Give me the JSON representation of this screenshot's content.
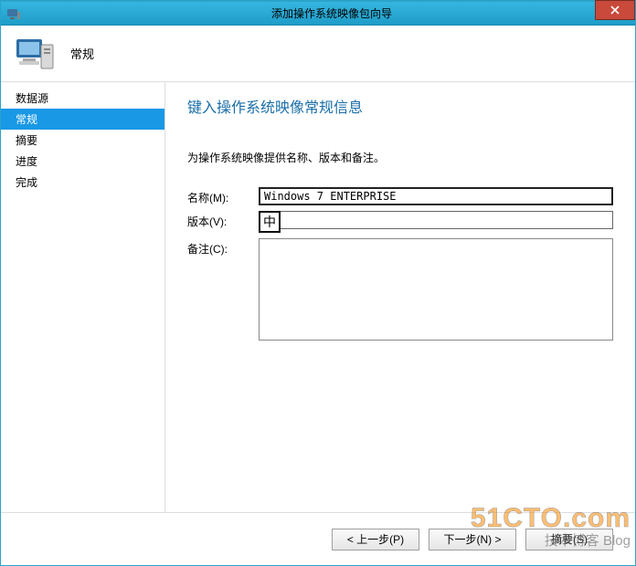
{
  "titlebar": {
    "title": "添加操作系统映像包向导",
    "close_label": "×"
  },
  "header": {
    "title": "常规"
  },
  "sidebar": {
    "items": [
      {
        "label": "数据源"
      },
      {
        "label": "常规"
      },
      {
        "label": "摘要"
      },
      {
        "label": "进度"
      },
      {
        "label": "完成"
      }
    ],
    "selected_index": 1
  },
  "content": {
    "heading": "键入操作系统映像常规信息",
    "instruction": "为操作系统映像提供名称、版本和备注。",
    "labels": {
      "name": "名称(M):",
      "version": "版本(V):",
      "comment": "备注(C):"
    },
    "values": {
      "name": "Windows 7 ENTERPRISE",
      "version": "",
      "comment": ""
    },
    "ime": "中"
  },
  "buttons": {
    "prev": "< 上一步(P)",
    "next": "下一步(N) >",
    "summary": "摘要(S)"
  },
  "watermark": {
    "big": "51CTO.com",
    "sub": "技术博客  Blog"
  }
}
